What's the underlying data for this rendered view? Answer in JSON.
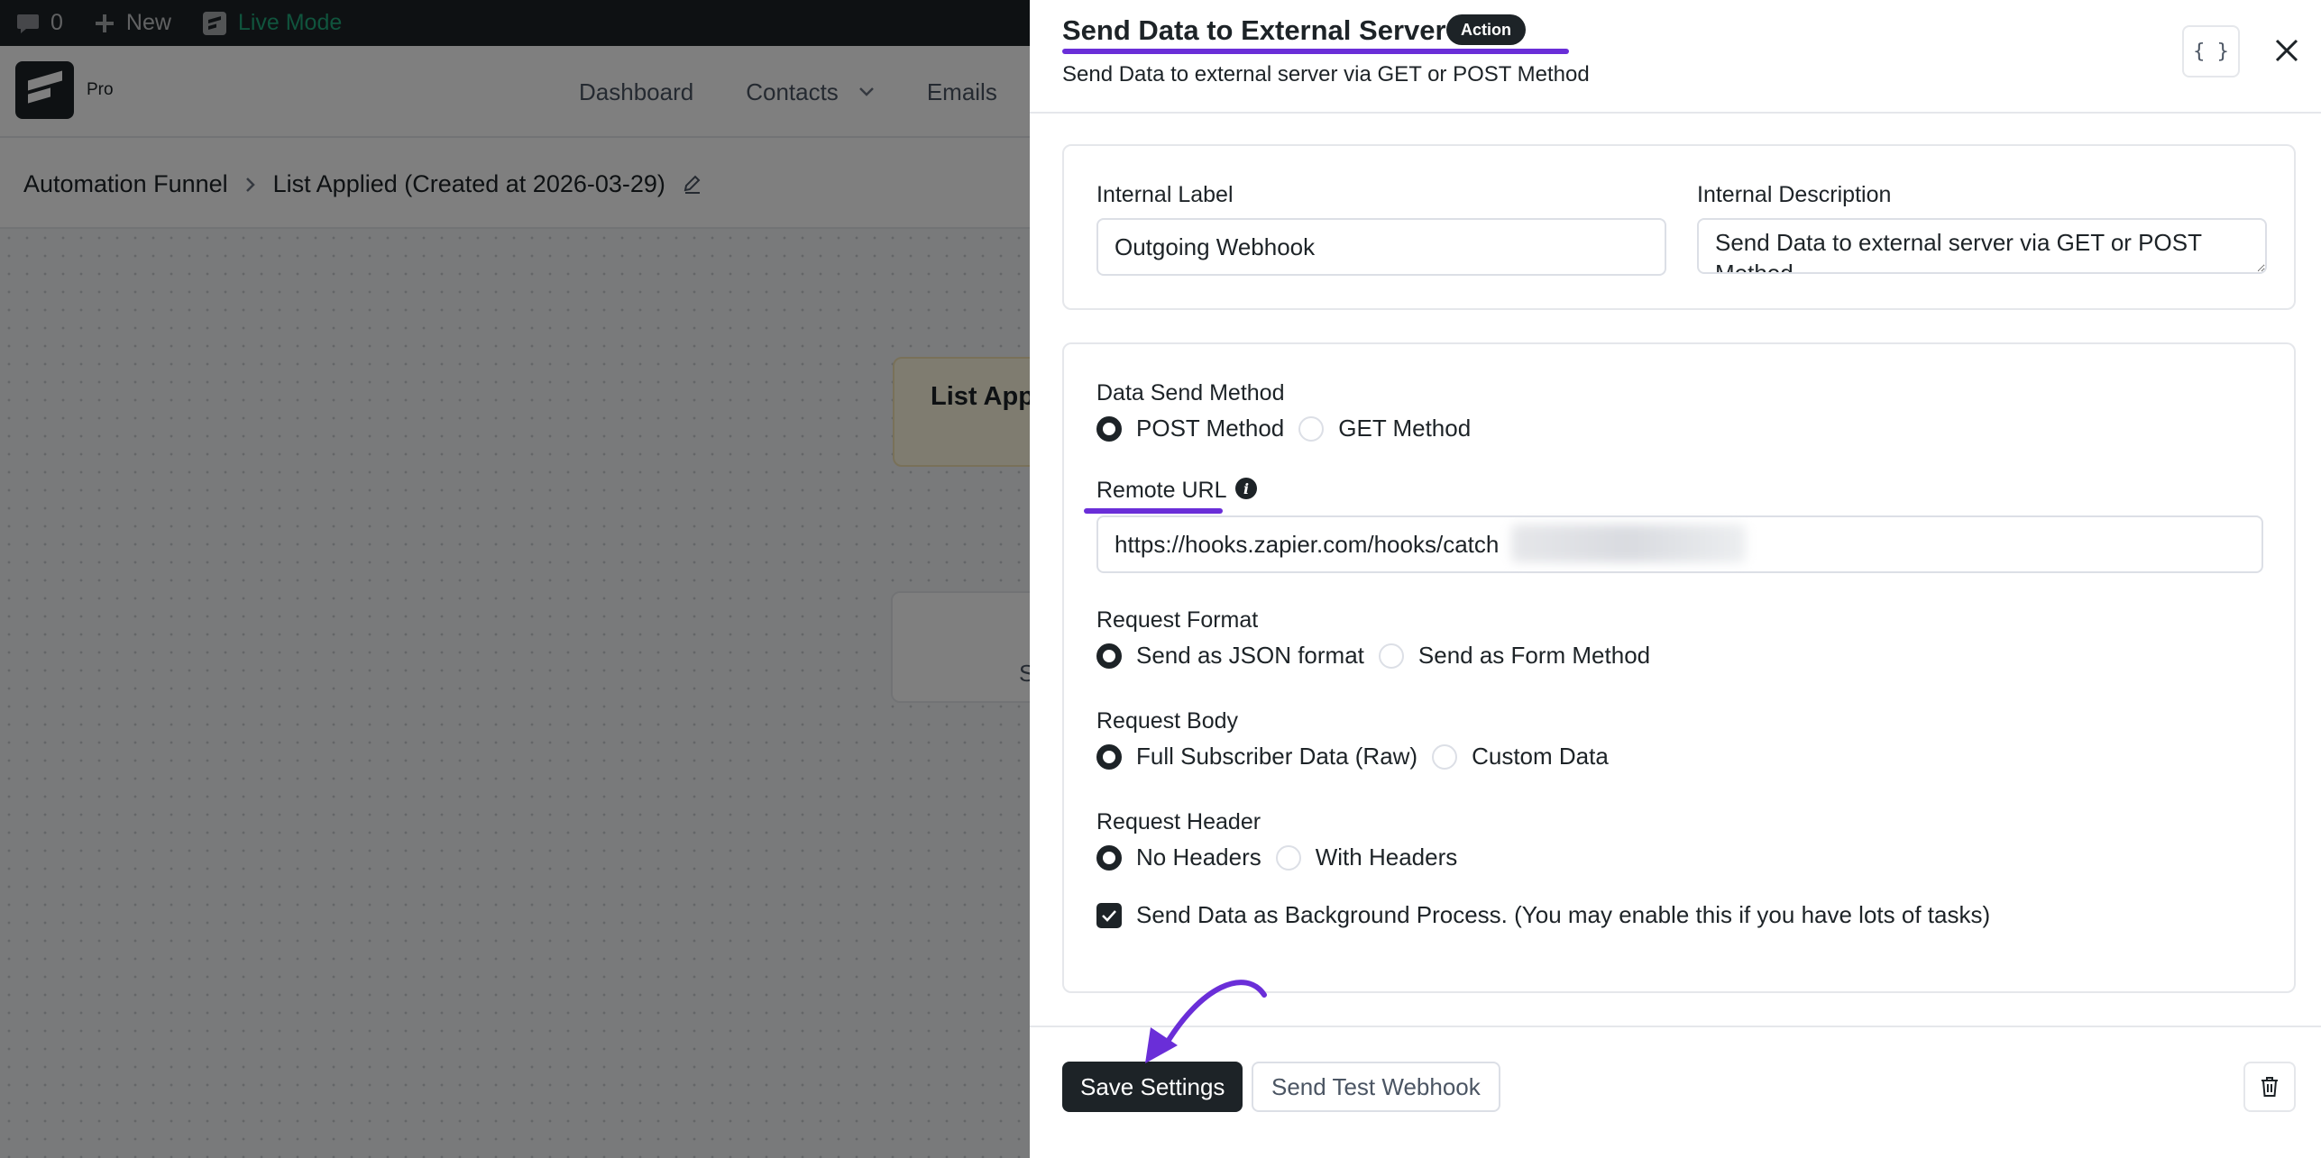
{
  "wp_bar": {
    "comments_count": "0",
    "new_label": "New",
    "live_mode_label": "Live Mode"
  },
  "app": {
    "logo_suffix": "Pro",
    "nav": [
      {
        "label": "Dashboard"
      },
      {
        "label": "Contacts"
      },
      {
        "label": "Emails"
      }
    ]
  },
  "breadcrumb": {
    "parent": "Automation Funnel",
    "current": "List Applied (Created at 2026-03-29)"
  },
  "canvas": {
    "trigger_title": "List App",
    "action_text": "S"
  },
  "drawer": {
    "title": "Send Data to External Server",
    "badge": "Action",
    "subtitle": "Send Data to external server via GET or POST Method",
    "json_button_label": "{ }",
    "labels_section": {
      "internal_label": "Internal Label",
      "internal_label_value": "Outgoing Webhook",
      "internal_description": "Internal Description",
      "internal_description_value": "Send Data to external server via GET or POST Method"
    },
    "settings": {
      "send_method": {
        "label": "Data Send Method",
        "options": [
          "POST Method",
          "GET Method"
        ],
        "selected": "POST Method"
      },
      "remote_url": {
        "label": "Remote URL",
        "value": "https://hooks.zapier.com/hooks/catch"
      },
      "request_format": {
        "label": "Request Format",
        "options": [
          "Send as JSON format",
          "Send as Form Method"
        ],
        "selected": "Send as JSON format"
      },
      "request_body": {
        "label": "Request Body",
        "options": [
          "Full Subscriber Data (Raw)",
          "Custom Data"
        ],
        "selected": "Full Subscriber Data (Raw)"
      },
      "request_header": {
        "label": "Request Header",
        "options": [
          "No Headers",
          "With Headers"
        ],
        "selected": "No Headers"
      },
      "background_process": {
        "label": "Send Data as Background Process. (You may enable this if you have lots of tasks)",
        "checked": true
      }
    },
    "footer": {
      "save_label": "Save Settings",
      "test_label": "Send Test Webhook"
    }
  },
  "colors": {
    "accent": "#6a2ed8",
    "primary_dark": "#1d2327",
    "live_green": "#20a87b"
  },
  "icons": [
    "comment-icon",
    "plus-icon",
    "live-mode-icon",
    "chevron-down-icon",
    "chevron-right-icon",
    "edit-icon",
    "info-icon",
    "code-icon",
    "close-icon",
    "check-icon",
    "trash-icon",
    "arrow-annotation-icon"
  ]
}
